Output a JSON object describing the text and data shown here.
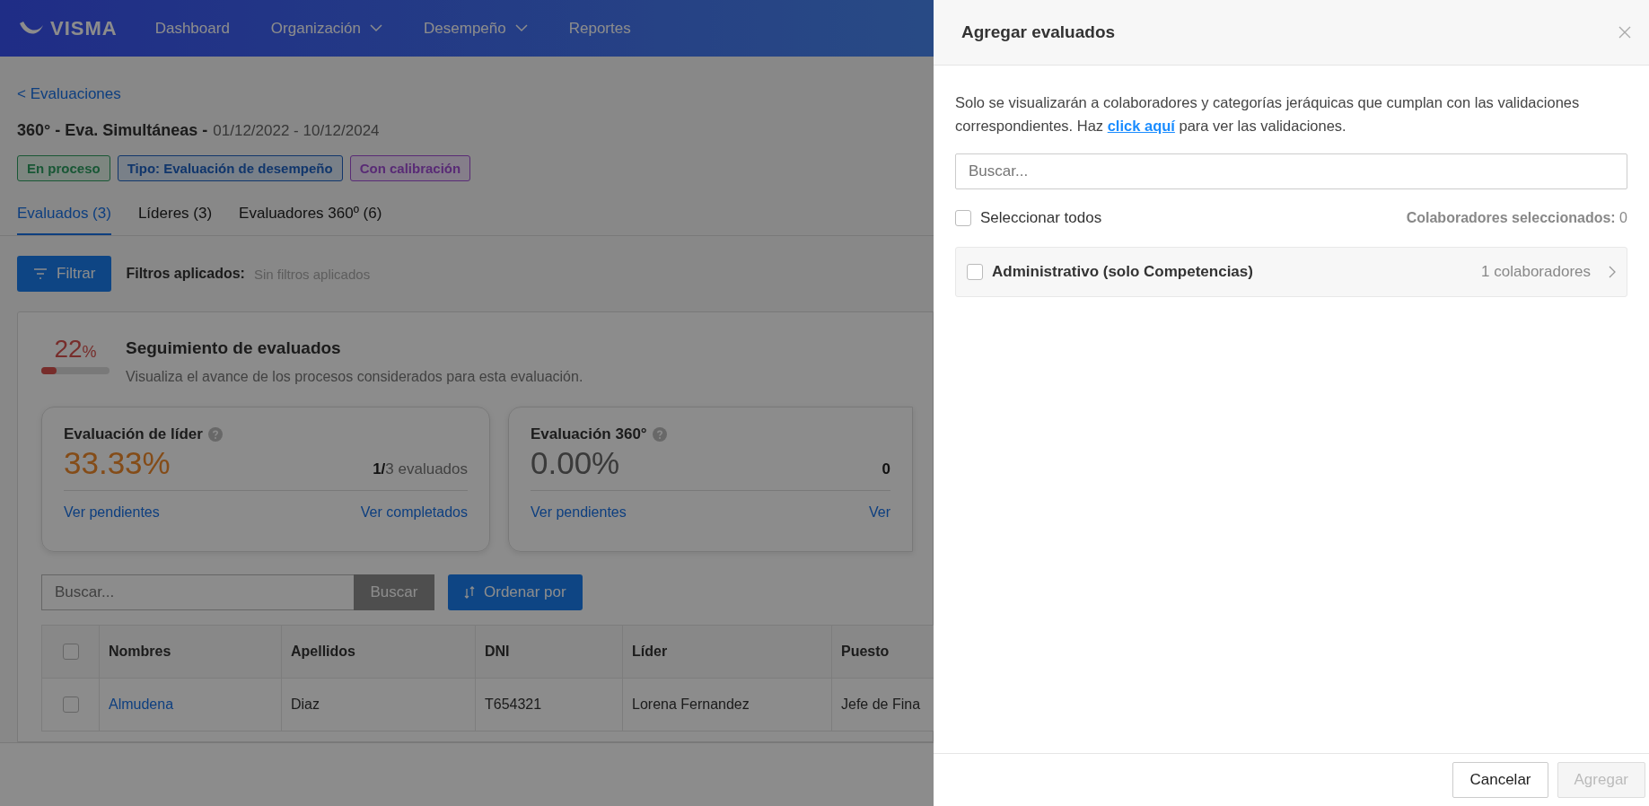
{
  "nav": {
    "logo": "VISMA",
    "items": [
      {
        "label": "Dashboard",
        "dropdown": false
      },
      {
        "label": "Organización",
        "dropdown": true
      },
      {
        "label": "Desempeño",
        "dropdown": true
      },
      {
        "label": "Reportes",
        "dropdown": false
      }
    ]
  },
  "back_link": "< Evaluaciones",
  "title": {
    "name": "360° - Eva. Simultáneas -",
    "dates": "01/12/2022 - 10/12/2024"
  },
  "tags": [
    {
      "label": "En proceso",
      "kind": "success"
    },
    {
      "label": "Tipo: Evaluación de desempeño",
      "kind": "info"
    },
    {
      "label": "Con calibración",
      "kind": "special"
    }
  ],
  "tabs": [
    {
      "label": "Evaluados (3)",
      "selected": true
    },
    {
      "label": "Líderes (3)",
      "selected": false
    },
    {
      "label": "Evaluadores 360º (6)",
      "selected": false
    }
  ],
  "filter": {
    "button": "Filtrar",
    "label": "Filtros aplicados:",
    "value": "Sin filtros aplicados"
  },
  "tracking": {
    "percent": "22",
    "unit": "%",
    "level": 0.22,
    "title": "Seguimiento de evaluados",
    "subtitle": "Visualiza el avance de los procesos considerados para esta evaluación."
  },
  "metric_cards": [
    {
      "title": "Evaluación de líder",
      "value": "33.33%",
      "kind": "warning",
      "count_done": "1/",
      "count_rest": "3 evaluados",
      "links": [
        "Ver pendientes",
        "Ver completados"
      ]
    },
    {
      "title": "Evaluación 360°",
      "value": "0.00%",
      "kind": "neutral",
      "count_done": "0",
      "links": [
        "Ver pendientes",
        "Ver"
      ]
    }
  ],
  "search": {
    "placeholder": "Buscar...",
    "button": "Buscar"
  },
  "sort_button": "Ordenar por",
  "table": {
    "header_checked": false,
    "columns": [
      "Nombres",
      "Apellidos",
      "DNI",
      "Líder",
      "Puesto"
    ],
    "rows": [
      {
        "checked": false,
        "cells": [
          "Almudena",
          "Diaz",
          "T654321",
          "Lorena Fernandez",
          "Jefe de Fina"
        ]
      }
    ]
  },
  "drawer": {
    "title": "Agregar evaluados",
    "description": "Solo se visualizarán a colaboradores y categorías jeráquicas que cumplan con las validaciones correspondientes. Haz",
    "link": "click aquí",
    "description_end": "para ver las validaciones.",
    "search_placeholder": "Buscar...",
    "select_all": {
      "label": "Seleccionar todos",
      "checked": false
    },
    "selected_count": {
      "label": "Colaboradores seleccionados:",
      "value": "0"
    },
    "categories": [
      {
        "name": "Administrativo (solo Competencias)",
        "count": "1 colaboradores",
        "checked": false
      }
    ],
    "buttons": [
      {
        "label": "Cancelar",
        "disabled": false
      },
      {
        "label": "Agregar",
        "disabled": true
      }
    ]
  }
}
